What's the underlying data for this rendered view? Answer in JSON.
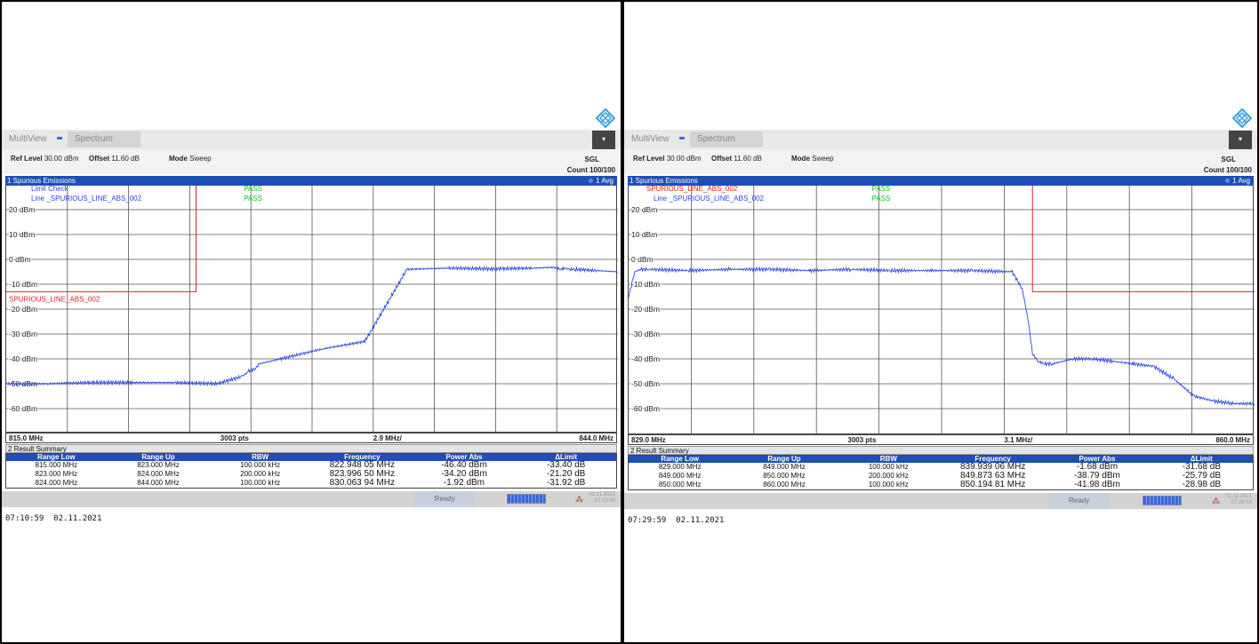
{
  "colors": {
    "trace": "#2a46e0",
    "limit": "#e02020",
    "pass": "#10c020",
    "header_blue": "#1f4fb6"
  },
  "panels": [
    {
      "header": {
        "tab_multiview": "MultiView",
        "tab_spectrum": "Spectrum",
        "ref_level_label": "Ref Level",
        "ref_level_value": "30.00 dBm",
        "offset_label": "Offset",
        "offset_value": "11.60 dB",
        "mode_label": "Mode",
        "mode_value": "Sweep",
        "sgl": "SGL",
        "count": "Count 100/100"
      },
      "window_title": "1 Spurious Emissions",
      "avg_label": "1 Avg",
      "legend": [
        {
          "text": "Limit Check",
          "color": "#2a46e0",
          "status": "PASS"
        },
        {
          "text": "Line _SPURIOUS_LINE_ABS_002",
          "color": "#2a46e0",
          "status": "PASS"
        }
      ],
      "limit_line_label": "SPURIOUS_LINE_ABS_002",
      "y_ticks": [
        "20 dBm",
        "10 dBm",
        "0 dBm",
        "-10 dBm",
        "-20 dBm",
        "-30 dBm",
        "-40 dBm",
        "-50 dBm",
        "-60 dBm"
      ],
      "x_start": "815.0 MHz",
      "points": "3003 pts",
      "span_per_div": "2.9 MHz/",
      "x_stop": "844.0 MHz",
      "result_summary_title": "2 Result Summary",
      "result_columns": [
        "Range Low",
        "Range Up",
        "RBW",
        "Frequency",
        "Power Abs",
        "ΔLimit"
      ],
      "result_rows": [
        [
          "815.000 MHz",
          "823.000 MHz",
          "100.000 kHz",
          "822.948 05 MHz",
          "-46.40 dBm",
          "-33.40 dB"
        ],
        [
          "823.000 MHz",
          "824.000 MHz",
          "200.000 kHz",
          "823.996 50 MHz",
          "-34.20 dBm",
          "-21.20 dB"
        ],
        [
          "824.000 MHz",
          "844.000 MHz",
          "100.000 kHz",
          "830.063 94 MHz",
          "-1.92 dBm",
          "-31.92 dB"
        ]
      ],
      "status_ready": "Ready",
      "status_date": "02.11.2021",
      "status_time": "07:10:59",
      "timestamp": "07:10:59  02.11.2021",
      "chart_data": {
        "type": "line",
        "xlim": [
          815.0,
          844.0
        ],
        "ylim": [
          -70,
          30
        ],
        "series": [
          {
            "name": "trace",
            "x": [
              815,
              817,
              819,
              821,
              823,
              825,
              825.8,
              826.2,
              826.5,
              826.8,
              827,
              828,
              830,
              832,
              834,
              836,
              838,
              840,
              841,
              841.3,
              841.5,
              841.7,
              842,
              843,
              844
            ],
            "y": [
              -50,
              -50,
              -49.5,
              -49.5,
              -49.5,
              -50,
              -48,
              -47,
              -45,
              -44,
              -42,
              -40,
              -36,
              -33,
              -4,
              -3.5,
              -3.8,
              -3.5,
              -3.2,
              -4,
              -3.5,
              -4,
              -4,
              -4.5,
              -5,
              -5,
              -5.5,
              -20,
              -35,
              -42,
              -44,
              -44
            ]
          },
          {
            "name": "SPURIOUS_LINE_ABS_002",
            "x": [
              815,
              824,
              824,
              844
            ],
            "y": [
              -13,
              -13,
              30,
              30
            ]
          }
        ]
      }
    },
    {
      "header": {
        "tab_multiview": "MultiView",
        "tab_spectrum": "Spectrum",
        "ref_level_label": "Ref Level",
        "ref_level_value": "30.00 dBm",
        "offset_label": "Offset",
        "offset_value": "11.60 dB",
        "mode_label": "Mode",
        "mode_value": "Sweep",
        "sgl": "SGL",
        "count": "Count 100/100"
      },
      "window_title": "1 Spurious Emissions",
      "avg_label": "1 Avg",
      "legend": [
        {
          "text": "SPURIOUS_LINE_ABS_002",
          "color": "#e02020",
          "status": "PASS"
        },
        {
          "text": "Line _SPURIOUS_LINE_ABS_002",
          "color": "#2a46e0",
          "status": "PASS"
        }
      ],
      "limit_line_label": "",
      "y_ticks": [
        "20 dBm",
        "10 dBm",
        "0 dBm",
        "-10 dBm",
        "-20 dBm",
        "-30 dBm",
        "-40 dBm",
        "-50 dBm",
        "-60 dBm"
      ],
      "x_start": "829.0 MHz",
      "points": "3003 pts",
      "span_per_div": "3.1 MHz/",
      "x_stop": "860.0 MHz",
      "result_summary_title": "2 Result Summary",
      "result_columns": [
        "Range Low",
        "Range Up",
        "RBW",
        "Frequency",
        "Power Abs",
        "ΔLimit"
      ],
      "result_rows": [
        [
          "829.000 MHz",
          "849.000 MHz",
          "100.000 kHz",
          "839.939 06 MHz",
          "-1.68 dBm",
          "-31.68 dB"
        ],
        [
          "849.000 MHz",
          "850.000 MHz",
          "200.000 kHz",
          "849.873 63 MHz",
          "-38.79 dBm",
          "-25.79 dB"
        ],
        [
          "850.000 MHz",
          "860.000 MHz",
          "100.000 kHz",
          "850.194 81 MHz",
          "-41.98 dBm",
          "-28.98 dB"
        ]
      ],
      "status_ready": "Ready",
      "status_date": "02.11.2021",
      "status_time": "07:29:59",
      "timestamp": "07:29:59  02.11.2021",
      "chart_data": {
        "type": "line",
        "xlim": [
          829.0,
          860.0
        ],
        "ylim": [
          -70,
          30
        ],
        "series": [
          {
            "name": "trace",
            "x": [
              829,
              829.3,
              829.6,
              830,
              832,
              834,
              836,
              838,
              840,
              842,
              844,
              846,
              848,
              848.5,
              848.8,
              849,
              849.3,
              849.6,
              850,
              851,
              852,
              853,
              854,
              855,
              856,
              857,
              858,
              859,
              860
            ],
            "y": [
              -15,
              -5,
              -4,
              -4,
              -4.5,
              -4,
              -4,
              -4.5,
              -4,
              -4.5,
              -4.5,
              -4.5,
              -5,
              -12,
              -25,
              -38,
              -41,
              -42,
              -42,
              -40,
              -40,
              -41,
              -42,
              -43,
              -48,
              -55,
              -57,
              -58,
              -58
            ]
          },
          {
            "name": "SPURIOUS_LINE_ABS_002",
            "x": [
              829,
              849,
              849,
              860
            ],
            "y": [
              30,
              30,
              -13,
              -13
            ]
          }
        ]
      }
    }
  ]
}
